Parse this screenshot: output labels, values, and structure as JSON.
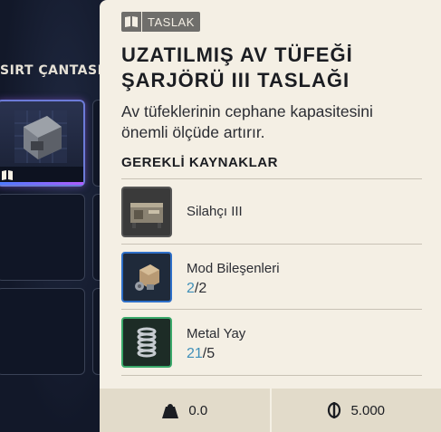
{
  "inventory": {
    "section_label": "SIRT ÇANTASI"
  },
  "blueprint": {
    "tag_label": "TASLAK",
    "title": "UZATILMIŞ AV TÜFEĞİ ŞARJÖRÜ III TASLAĞI",
    "description": "Av tüfeklerinin cephane kapasitesini önemli ölçüde artırır."
  },
  "requirements": {
    "heading": "GEREKLİ KAYNAKLAR",
    "items": [
      {
        "name": "Silahçı III",
        "icon": "workbench-icon"
      },
      {
        "name": "Mod Bileşenleri",
        "have": "2",
        "need": "/2",
        "icon": "mod-components-icon"
      },
      {
        "name": "Metal Yay",
        "have": "21",
        "need": "/5",
        "icon": "metal-spring-icon"
      }
    ]
  },
  "footer": {
    "weight": "0.0",
    "price": "5.000"
  },
  "colors": {
    "panel_bg": "#f4efe4",
    "have_count": "#3f8fb8",
    "rarity_uncommon": "#3aa86a",
    "rarity_rare": "#2e6fc8"
  }
}
